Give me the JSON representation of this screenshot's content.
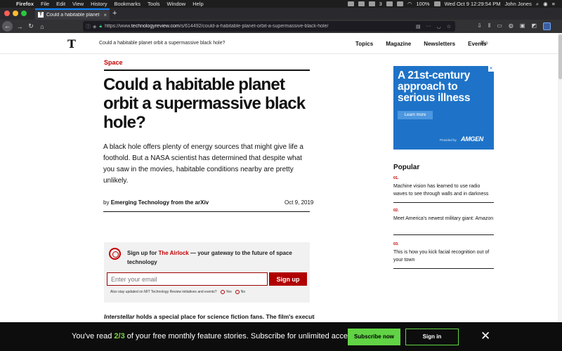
{
  "menubar": {
    "app": "Firefox",
    "menus": [
      "File",
      "Edit",
      "View",
      "History",
      "Bookmarks",
      "Tools",
      "Window",
      "Help"
    ],
    "badge_count": "3",
    "battery": "100%",
    "datetime": "Wed Oct 9  12:29:54 PM",
    "user": "John Jones"
  },
  "browser": {
    "tab_title": "Could a habitable planet orbit a",
    "url_prefix": "https://www.",
    "url_domain": "technologyreview.com",
    "url_path": "/s/614492/could-a-habitable-planet-orbit-a-supermassive-black-hole/"
  },
  "site": {
    "logo": "T",
    "header_title": "Could a habitable planet orbit a supermassive black hole?",
    "nav": [
      "Topics",
      "Magazine",
      "Newsletters",
      "Events"
    ]
  },
  "article": {
    "section": "Space",
    "headline": "Could a habitable planet orbit a supermassive black hole?",
    "dek": "A black hole offers plenty of energy sources that might give life a foothold. But a NASA scientist has determined that despite what you saw in the movies, habitable conditions nearby are pretty unlikely.",
    "byline_prefix": "by",
    "author": "Emerging Technology from the arXiv",
    "date": "Oct 9, 2019",
    "body_italic": "Interstellar",
    "body_rest": "holds a special place for science fiction fans. The film's executive"
  },
  "newsletter": {
    "text_prefix": "Sign up for",
    "name": "The Airlock",
    "text_suffix": "— your gateway to the future of space technology",
    "email_placeholder": "Enter your email",
    "button": "Sign up",
    "consent": "Also stay updated on MIT Technology Review initiatives and events?",
    "yes": "Yes",
    "no": "No"
  },
  "ad": {
    "headline": "A 21st-century approach to serious illness",
    "button": "Learn more",
    "provided_by": "Provided by",
    "brand": "AMGEN"
  },
  "popular": {
    "title": "Popular",
    "items": [
      {
        "num": "01.",
        "text": "Machine vision has learned to use radio waves to see through walls and in darkness"
      },
      {
        "num": "02.",
        "text": "Meet America's newest military giant: Amazon"
      },
      {
        "num": "03.",
        "text": "This is how you kick facial recognition out of your town"
      }
    ]
  },
  "paywall": {
    "before": "You've read",
    "count": "2/3",
    "after": "of your free monthly feature stories. Subscribe for unlimited access.",
    "subscribe": "Subscribe now",
    "signin": "Sign in",
    "close": "✕"
  }
}
